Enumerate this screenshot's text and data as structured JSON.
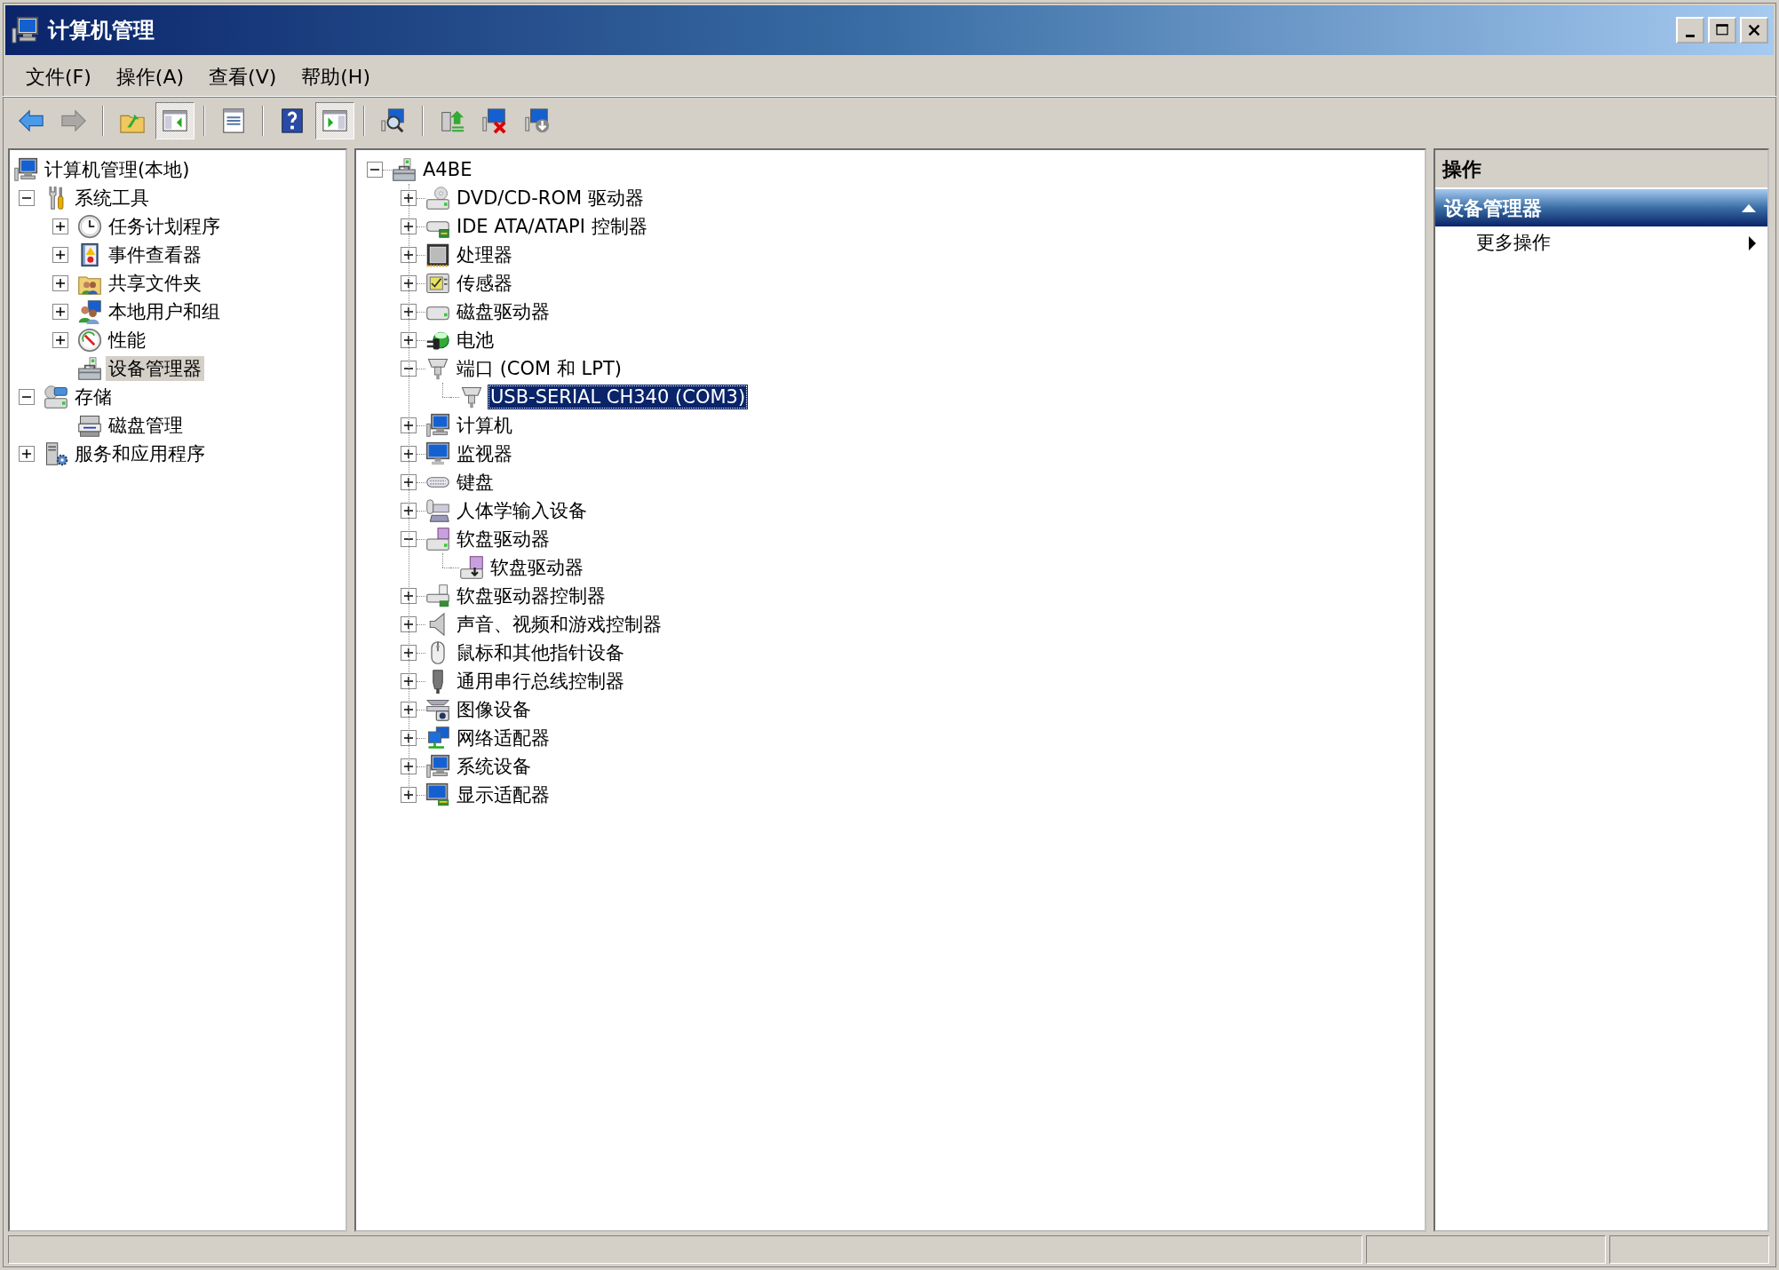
{
  "window": {
    "title": "计算机管理"
  },
  "menu": [
    {
      "label": "文件(F)"
    },
    {
      "label": "操作(A)"
    },
    {
      "label": "查看(V)"
    },
    {
      "label": "帮助(H)"
    }
  ],
  "toolbar": [
    {
      "kind": "back",
      "pressed": false,
      "disabled": false
    },
    {
      "kind": "forward",
      "pressed": false,
      "disabled": true
    },
    {
      "kind": "separator"
    },
    {
      "kind": "up",
      "pressed": false,
      "disabled": false
    },
    {
      "kind": "console-tree",
      "pressed": true,
      "disabled": false
    },
    {
      "kind": "separator"
    },
    {
      "kind": "properties",
      "pressed": false,
      "disabled": false
    },
    {
      "kind": "separator"
    },
    {
      "kind": "help",
      "pressed": false,
      "disabled": false
    },
    {
      "kind": "action-pane",
      "pressed": true,
      "disabled": false
    },
    {
      "kind": "separator"
    },
    {
      "kind": "scan",
      "pressed": false,
      "disabled": false
    },
    {
      "kind": "separator"
    },
    {
      "kind": "update",
      "pressed": false,
      "disabled": false
    },
    {
      "kind": "uninstall",
      "pressed": false,
      "disabled": false
    },
    {
      "kind": "rollback",
      "pressed": false,
      "disabled": false
    }
  ],
  "left_tree": [
    {
      "label": "计算机管理(本地)",
      "kind": "computer",
      "selected": false,
      "children": [
        {
          "label": "系统工具",
          "kind": "tools",
          "expanded": true,
          "selected": false,
          "children": [
            {
              "label": "任务计划程序",
              "kind": "clock",
              "expanded": false,
              "selected": false
            },
            {
              "label": "事件查看器",
              "kind": "log",
              "expanded": false,
              "selected": false
            },
            {
              "label": "共享文件夹",
              "kind": "share",
              "expanded": false,
              "selected": false
            },
            {
              "label": "本地用户和组",
              "kind": "users",
              "expanded": false,
              "selected": false
            },
            {
              "label": "性能",
              "kind": "gauge",
              "expanded": false,
              "selected": false
            },
            {
              "label": "设备管理器",
              "kind": "toolbox",
              "selected": true
            }
          ]
        },
        {
          "label": "存储",
          "kind": "storage",
          "expanded": true,
          "selected": false,
          "children": [
            {
              "label": "磁盘管理",
              "kind": "diskmgmt",
              "selected": false
            }
          ]
        },
        {
          "label": "服务和应用程序",
          "kind": "server",
          "expanded": false,
          "selected": false
        }
      ]
    }
  ],
  "device_tree": [
    {
      "label": "A4BE",
      "kind": "toolbox",
      "expanded": true,
      "selected": false,
      "children": [
        {
          "label": "DVD/CD-ROM 驱动器",
          "kind": "dvd",
          "expanded": false,
          "selected": false
        },
        {
          "label": "IDE ATA/ATAPI 控制器",
          "kind": "controller",
          "expanded": false,
          "selected": false
        },
        {
          "label": "处理器",
          "kind": "cpu",
          "expanded": false,
          "selected": false
        },
        {
          "label": "传感器",
          "kind": "sensor",
          "expanded": false,
          "selected": false
        },
        {
          "label": "磁盘驱动器",
          "kind": "drive",
          "expanded": false,
          "selected": false
        },
        {
          "label": "电池",
          "kind": "battery",
          "expanded": false,
          "selected": false
        },
        {
          "label": "端口 (COM 和 LPT)",
          "kind": "port",
          "expanded": true,
          "selected": false,
          "children": [
            {
              "label": "USB-SERIAL CH340 (COM3)",
              "kind": "port",
              "selected": true
            }
          ]
        },
        {
          "label": "计算机",
          "kind": "computer",
          "expanded": false,
          "selected": false
        },
        {
          "label": "监视器",
          "kind": "monitor",
          "expanded": false,
          "selected": false
        },
        {
          "label": "键盘",
          "kind": "keyboard",
          "expanded": false,
          "selected": false
        },
        {
          "label": "人体学输入设备",
          "kind": "hid",
          "expanded": false,
          "selected": false
        },
        {
          "label": "软盘驱动器",
          "kind": "floppy",
          "expanded": true,
          "selected": false,
          "children": [
            {
              "label": "软盘驱动器",
              "kind": "floppydev",
              "selected": false
            }
          ]
        },
        {
          "label": "软盘驱动器控制器",
          "kind": "floppyctl",
          "expanded": false,
          "selected": false
        },
        {
          "label": "声音、视频和游戏控制器",
          "kind": "speaker",
          "expanded": false,
          "selected": false
        },
        {
          "label": "鼠标和其他指针设备",
          "kind": "mouse",
          "expanded": false,
          "selected": false
        },
        {
          "label": "通用串行总线控制器",
          "kind": "usb",
          "expanded": false,
          "selected": false
        },
        {
          "label": "图像设备",
          "kind": "camera",
          "expanded": false,
          "selected": false
        },
        {
          "label": "网络适配器",
          "kind": "network",
          "expanded": false,
          "selected": false
        },
        {
          "label": "系统设备",
          "kind": "computer",
          "expanded": false,
          "selected": false
        },
        {
          "label": "显示适配器",
          "kind": "display",
          "expanded": false,
          "selected": false
        }
      ]
    }
  ],
  "actions": {
    "title": "操作",
    "sections": [
      {
        "title": "设备管理器",
        "expanded": true,
        "items": [
          {
            "label": "更多操作",
            "submenu": true
          }
        ]
      }
    ]
  }
}
